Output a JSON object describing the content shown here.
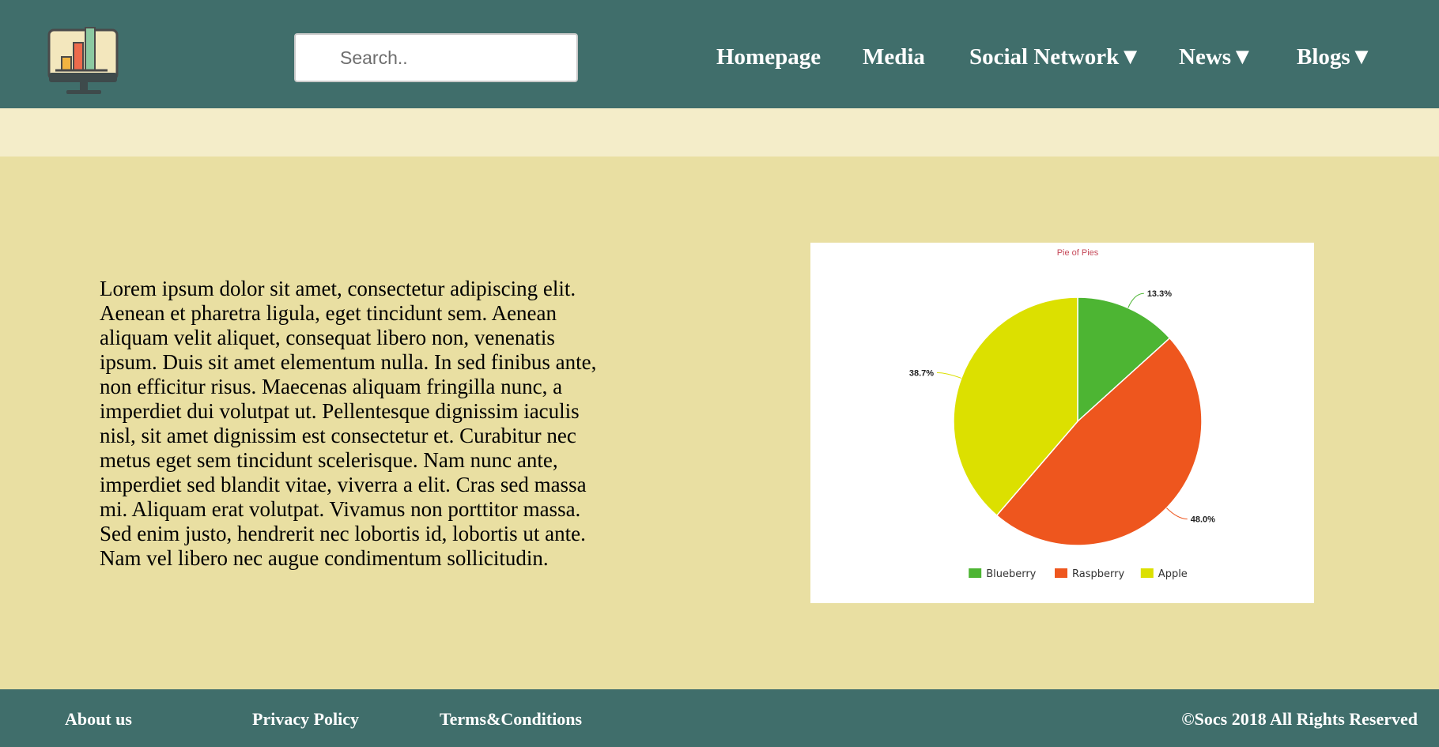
{
  "header": {
    "search_placeholder": "Search..",
    "nav": {
      "homepage": "Homepage",
      "media": "Media",
      "social_network": "Social Network▼",
      "news": "News▼",
      "blogs": "Blogs▼"
    }
  },
  "main": {
    "paragraph": "Lorem ipsum dolor sit amet, consectetur adipiscing elit. Aenean et pharetra ligula, eget tincidunt sem. Aenean aliquam velit aliquet, consequat libero non, venenatis ipsum. Duis sit amet elementum nulla. In sed finibus ante, non efficitur risus. Maecenas aliquam fringilla nunc, a imperdiet dui volutpat ut. Pellentesque dignissim iaculis nisl, sit amet dignissim est consectetur et. Curabitur nec metus eget sem tincidunt scelerisque. Nam nunc ante, imperdiet sed blandit vitae, viverra a elit. Cras sed massa mi. Aliquam erat volutpat. Vivamus non porttitor massa. Sed enim justo, hendrerit nec lobortis id, lobortis ut ante. Nam vel libero nec augue condimentum sollicitudin."
  },
  "chart_data": {
    "type": "pie",
    "title": "Pie of Pies",
    "legend_position": "bottom",
    "categories": [
      "Blueberry",
      "Raspberry",
      "Apple"
    ],
    "values": [
      13.3,
      48.0,
      38.7
    ],
    "labels": [
      "13.3%",
      "48.0%",
      "38.7%"
    ],
    "colors": [
      "#4db533",
      "#ee561e",
      "#dce000"
    ],
    "title_color": "#c64a5a"
  },
  "footer": {
    "about": "About us",
    "privacy": "Privacy Policy",
    "terms": "Terms&Conditions",
    "copyright": "©Socs 2018 All Rights Reserved"
  },
  "icons": {
    "logo": "monitor-bar-chart-icon"
  },
  "colors": {
    "header_bg": "#406e6b",
    "page_bg": "#e9dfa2",
    "band_bg": "#f4edc9"
  }
}
